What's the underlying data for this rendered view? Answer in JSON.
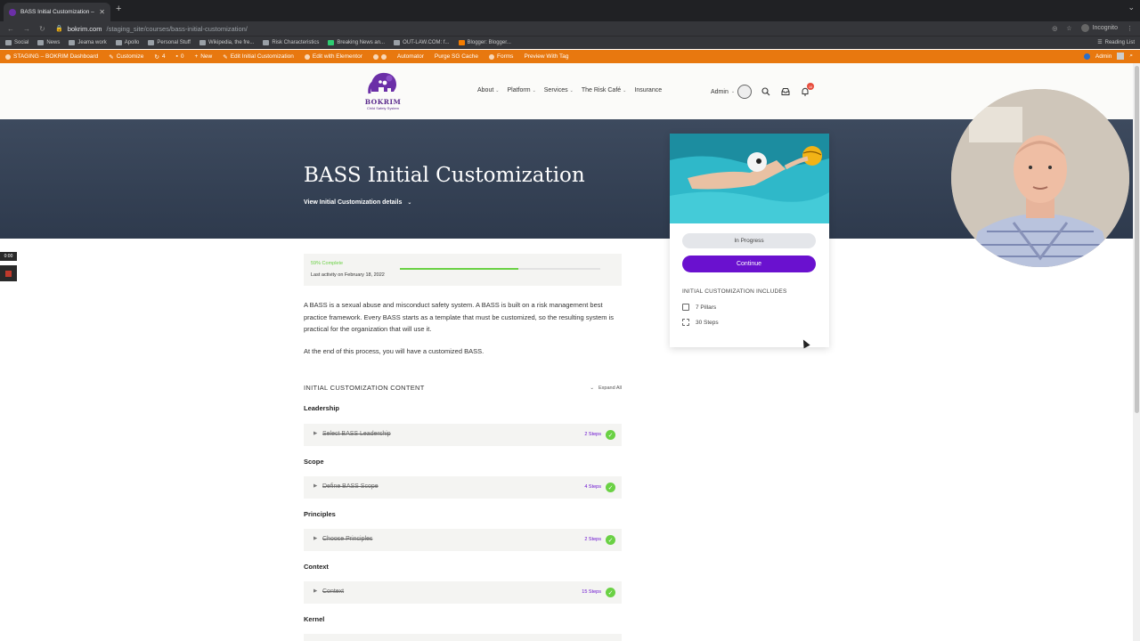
{
  "browser": {
    "tab_title": "BASS Initial Customization – B",
    "url_host": "bokrim.com",
    "url_path": "/staging_site/courses/bass-initial-customization/",
    "incognito_label": "Incognito",
    "bookmarks": [
      "Social",
      "News",
      "Jeama work",
      "Apollo",
      "Personal Stuff",
      "Wikipedia, the fre...",
      "Risk Characteristics",
      "Breaking News an...",
      "OUT-LAW.COM: f...",
      "Blogger: Blogger..."
    ],
    "reading_list": "Reading List"
  },
  "wp_admin": {
    "items": [
      "STAGING – BOKRIM Dashboard",
      "Customize",
      "4",
      "0",
      "New",
      "Edit Initial Customization",
      "Edit with Elementor",
      "Automator",
      "Purge SG Cache",
      "Forms",
      "Preview With Tag"
    ],
    "right_label": "Admin"
  },
  "header": {
    "brand": "BOKRIM",
    "tagline": "Child Safety System",
    "nav": [
      "About",
      "Platform",
      "Services",
      "The Risk Café",
      "Insurance"
    ],
    "admin_label": "Admin",
    "notification_count": "10"
  },
  "hero": {
    "title": "BASS Initial Customization",
    "details_link": "View Initial Customization details"
  },
  "card": {
    "status": "In Progress",
    "continue_label": "Continue",
    "includes_title": "INITIAL CUSTOMIZATION INCLUDES",
    "includes": [
      "7 Pillars",
      "30 Steps"
    ]
  },
  "recorder": {
    "time": "0:00"
  },
  "progress": {
    "percent_label": "59% Complete",
    "percent_value": 59,
    "last_activity": "Last activity on February 18, 2022"
  },
  "description": {
    "p1": "A BASS is a sexual abuse and misconduct safety system. A BASS is built on a risk management best practice framework. Every BASS starts as a template that must be customized, so the resulting system is practical for the organization that will use it.",
    "p2": "At the end of this process, you will have a customized BASS."
  },
  "content": {
    "title": "INITIAL CUSTOMIZATION CONTENT",
    "expand_all": "Expand All",
    "sections": [
      {
        "label": "Leadership",
        "lesson": "Select BASS Leadership",
        "steps": "2 Steps"
      },
      {
        "label": "Scope",
        "lesson": "Define BASS Scope",
        "steps": "4 Steps"
      },
      {
        "label": "Principles",
        "lesson": "Choose Principles",
        "steps": "2 Steps"
      },
      {
        "label": "Context",
        "lesson": "Context",
        "steps": "15 Steps"
      }
    ],
    "next_section": "Kernel"
  },
  "colors": {
    "accent": "#6a11cf",
    "success": "#6ad144",
    "wp_bar": "#e8780f",
    "hero_bg": "#3d4a5e"
  }
}
